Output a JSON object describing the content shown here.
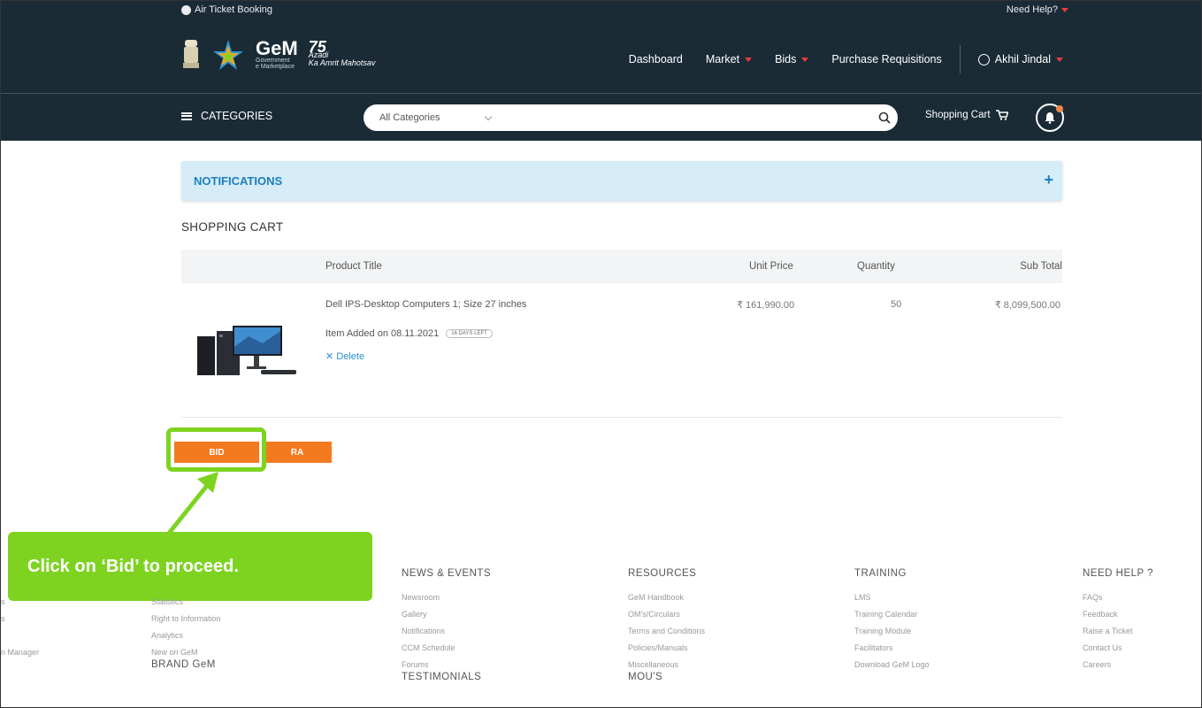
{
  "header": {
    "utility_left": "Air Ticket Booking",
    "utility_right": "Need Help?",
    "brand_name": "GeM",
    "brand_sub_1": "Government",
    "brand_sub_2": "e Marketplace",
    "azadi_1": "Azadi",
    "azadi_2": "Ka Amrit Mahotsav",
    "nav": {
      "dashboard": "Dashboard",
      "market": "Market",
      "bids": "Bids",
      "purchase_requisitions": "Purchase Requisitions",
      "user": "Akhil Jindal"
    }
  },
  "catbar": {
    "categories_label": "CATEGORIES",
    "search_select": "All Categories",
    "search_value": "",
    "cart_label": "Shopping Cart"
  },
  "notifications": {
    "title": "NOTIFICATIONS",
    "toggle": "+"
  },
  "cart": {
    "heading": "SHOPPING CART",
    "columns": {
      "title": "Product Title",
      "price": "Unit Price",
      "qty": "Quantity",
      "subtotal": "Sub Total"
    },
    "item": {
      "title": "Dell IPS-Desktop Computers 1; Size 27 inches",
      "price": "₹ 161,990.00",
      "qty": "50",
      "subtotal": "₹ 8,099,500.00",
      "added": "Item Added on 08.11.2021",
      "days_badge": "16 DAYS LEFT",
      "delete": "✕ Delete"
    }
  },
  "actions": {
    "bid": "BID",
    "ra": "RA"
  },
  "callout": {
    "text": "Click on ‘Bid’ to proceed."
  },
  "footer": {
    "left_links": [
      "Statistics",
      "Right to Information",
      "Analytics",
      "New on GeM"
    ],
    "left_bottom": "BRAND GeM",
    "edge_links": [
      "s",
      "s",
      "",
      "n Manager"
    ],
    "news": {
      "title": "NEWS & EVENTS",
      "links": [
        "Newsroom",
        "Gallery",
        "Notifications",
        "CCM Schedule",
        "Forums"
      ],
      "bottom": "TESTIMONIALS"
    },
    "resources": {
      "title": "RESOURCES",
      "links": [
        "GeM Handbook",
        "OM's/Circulars",
        "Terms and Conditions",
        "Policies/Manuals",
        "Miscellaneous"
      ],
      "bottom": "MOU'S"
    },
    "training": {
      "title": "TRAINING",
      "links": [
        "LMS",
        "Training Calendar",
        "Training Module",
        "Facilitators",
        "Download GeM Logo"
      ]
    },
    "help": {
      "title": "NEED HELP ?",
      "links": [
        "FAQs",
        "Feedback",
        "Raise a Ticket",
        "Contact Us",
        "Careers"
      ]
    }
  },
  "colors": {
    "header_bg": "#1a2b36",
    "accent_orange": "#f47a20",
    "callout_green": "#7ed321",
    "notif_bg": "#d6ecf7",
    "link_blue": "#2a8fd6"
  }
}
